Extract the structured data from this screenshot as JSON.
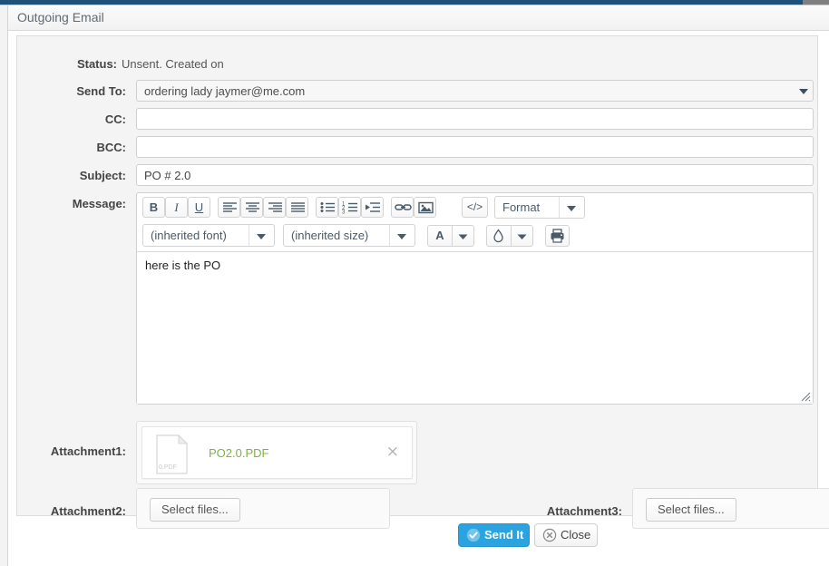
{
  "window": {
    "title": "Outgoing Email",
    "accent_blue": "#1f5279",
    "panel_bg": "#f4f4f4"
  },
  "form": {
    "status_label": "Status:",
    "status_value": "Unsent. Created on",
    "fields": [
      {
        "label": "Send To:",
        "value": "ordering lady jaymer@me.com",
        "placeholder": ""
      },
      {
        "label": "CC:",
        "value": "",
        "placeholder": ""
      },
      {
        "label": "BCC:",
        "value": "",
        "placeholder": ""
      },
      {
        "label": "Subject:",
        "value": "PO # 2.0",
        "placeholder": ""
      }
    ],
    "message_label": "Message:",
    "message_value": "here is the PO",
    "message_placeholder": ""
  },
  "editor": {
    "toolbar_row1": [
      {
        "name": "bold-icon",
        "label": "B"
      },
      {
        "name": "italic-icon",
        "label": "I"
      },
      {
        "name": "underline-icon",
        "label": "U"
      },
      {
        "name": "align-left-icon",
        "label": ""
      },
      {
        "name": "align-center-icon",
        "label": ""
      },
      {
        "name": "align-right-icon",
        "label": ""
      },
      {
        "name": "align-justify-icon",
        "label": ""
      },
      {
        "name": "bullet-list-icon",
        "label": ""
      },
      {
        "name": "numbered-list-icon",
        "label": ""
      },
      {
        "name": "indent-icon",
        "label": ""
      },
      {
        "name": "link-icon",
        "label": ""
      },
      {
        "name": "image-icon",
        "label": ""
      },
      {
        "name": "source-code-icon",
        "label": "</>"
      }
    ],
    "format_select": "Format",
    "font_select": "(inherited font)",
    "size_select": "(inherited size)",
    "text_color_label": "A",
    "background_color_icon": "droplet-icon",
    "print_icon": "printer-icon"
  },
  "attachments": {
    "slot1_label": "Attachment1:",
    "slot2_label": "Attachment2:",
    "slot3_label": "Attachment3:",
    "file": {
      "name": "PO2.0.PDF",
      "icon_caption": "0.PDF",
      "name_color": "#7cb342",
      "remove_label": "×"
    },
    "select_files_label": "Select files..."
  },
  "footer": {
    "send_label": "Send It",
    "close_label": "Close",
    "send_color": "#2aa3e0"
  }
}
